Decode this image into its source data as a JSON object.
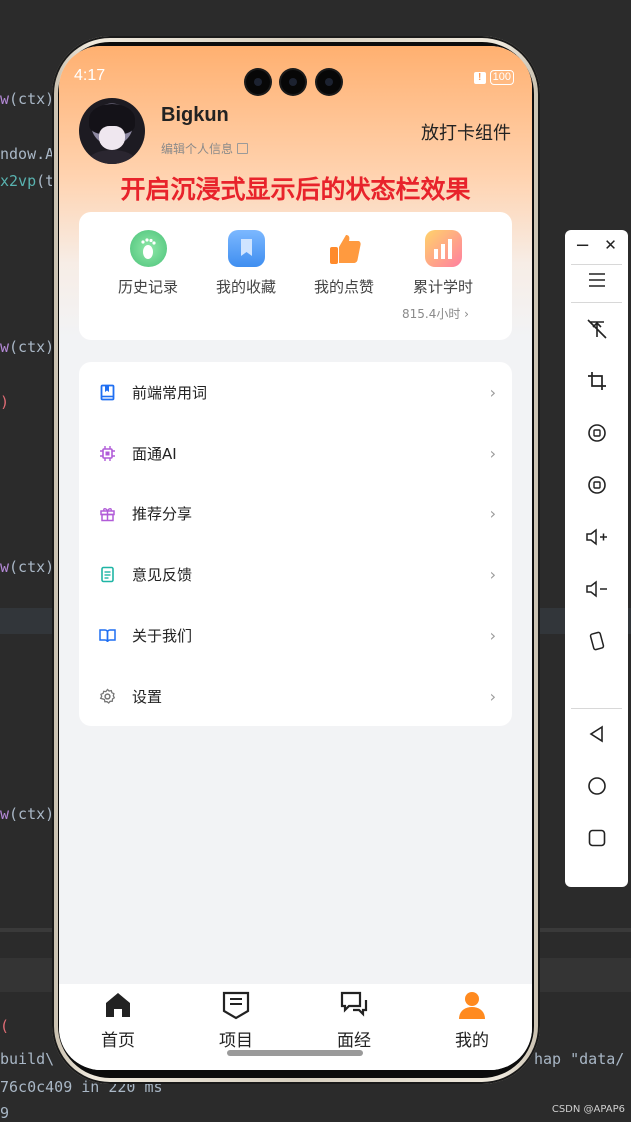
{
  "editor": {
    "lines": [
      {
        "pre": "",
        "fn": "w",
        "rest": "(ctx)"
      },
      {
        "pre": "ndow.A",
        "fn": "",
        "rest": ""
      },
      {
        "pre": "",
        "fn": "",
        "teal": "x2vp",
        "rest": "(t"
      },
      {
        "pre": "",
        "fn": "w",
        "rest": "(ctx)"
      },
      {
        "pre": "",
        "fn": "",
        "pink": ")",
        "rest": ""
      },
      {
        "pre": "",
        "fn": "w",
        "rest": "(ctx)"
      },
      {
        "pre": "",
        "fn": "w",
        "rest": "(ctx)"
      },
      {
        "pre": "",
        "fn": "",
        "pink": "(",
        "rest": ""
      },
      {
        "pre": "build\\",
        "fn": "",
        "rest": ""
      },
      {
        "pre": "76c0c409  in 220 ms",
        "fn": "",
        "rest": ""
      },
      {
        "pre": "9",
        "fn": "",
        "rest": ""
      }
    ],
    "right_text": "hap \"data/",
    "watermark": "CSDN @APAP6"
  },
  "status_bar": {
    "time": "4:17",
    "battery": "100",
    "warning": "!"
  },
  "profile": {
    "username": "Bigkun",
    "edit_label": "编辑个人信息",
    "widget_button": "放打卡组件"
  },
  "banner": "开启沉浸式显示后的状态栏效果",
  "stats": [
    {
      "label": "历史记录",
      "icon": "footprint-icon",
      "color": "#5fd38a"
    },
    {
      "label": "我的收藏",
      "icon": "bookmark-icon",
      "color": "#4d9cf5"
    },
    {
      "label": "我的点赞",
      "icon": "thumbs-up-icon",
      "color": "#ff8a2b"
    },
    {
      "label": "累计学时",
      "icon": "bar-chart-icon",
      "color": "#ff9a7a"
    }
  ],
  "study_hours": "815.4小时 ›",
  "menu": [
    {
      "label": "前端常用词",
      "icon": "book-icon",
      "color": "#1f6ff2"
    },
    {
      "label": "面通AI",
      "icon": "chip-icon",
      "color": "#b15cd8"
    },
    {
      "label": "推荐分享",
      "icon": "gift-icon",
      "color": "#b15cd8"
    },
    {
      "label": "意见反馈",
      "icon": "document-icon",
      "color": "#1fb5a5"
    },
    {
      "label": "关于我们",
      "icon": "open-book-icon",
      "color": "#1f6ff2"
    },
    {
      "label": "设置",
      "icon": "gear-icon",
      "color": "#777777"
    }
  ],
  "tabs": [
    {
      "label": "首页",
      "icon": "home-icon"
    },
    {
      "label": "项目",
      "icon": "project-icon"
    },
    {
      "label": "面经",
      "icon": "chat-icon"
    },
    {
      "label": "我的",
      "icon": "user-icon",
      "color": "#ff8a1f"
    }
  ],
  "toolbar": {
    "minimize": "−",
    "close": "✕",
    "items": [
      "menu-icon",
      "pin-off-icon",
      "crop-icon",
      "rotate-left-icon",
      "rotate-right-icon",
      "volume-up-icon",
      "volume-down-icon",
      "shake-icon",
      "back-icon",
      "home-circle-icon",
      "recents-icon"
    ]
  }
}
